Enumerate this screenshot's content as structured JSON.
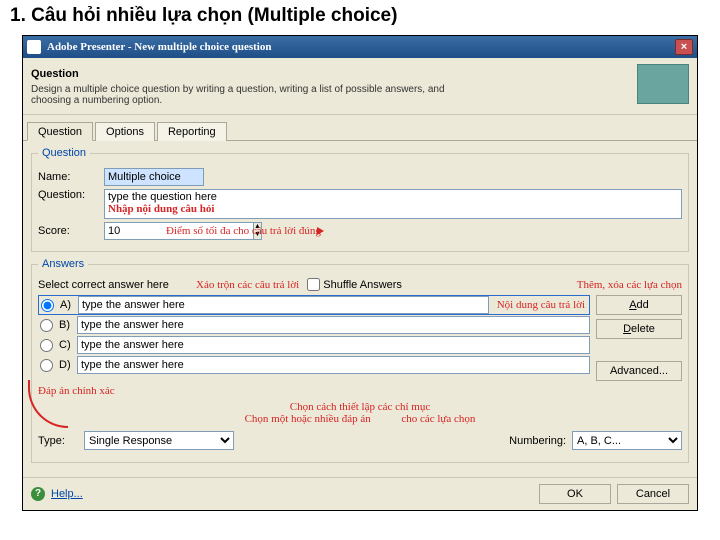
{
  "slide": {
    "title": "1. Câu hỏi nhiều lựa chọn (Multiple choice)"
  },
  "window": {
    "title": "Adobe Presenter - New multiple choice question"
  },
  "header": {
    "title": "Question",
    "desc": "Design a multiple choice question by writing a question, writing a list of possible answers, and choosing a numbering option."
  },
  "tabs": {
    "t1": "Question",
    "t2": "Options",
    "t3": "Reporting"
  },
  "group": {
    "question": "Question",
    "answers": "Answers"
  },
  "labels": {
    "name": "Name:",
    "question": "Question:",
    "score": "Score:",
    "type": "Type:",
    "numbering": "Numbering:",
    "select_hint": "Select correct answer here"
  },
  "fields": {
    "name": "Multiple choice",
    "question": "type the question here",
    "score": "10",
    "answer_ph": "type the answer here",
    "type": "Single Response",
    "numbering": "A, B, C..."
  },
  "letters": {
    "a": "A)",
    "b": "B)",
    "c": "C)",
    "d": "D)"
  },
  "shuffle": "Shuffle Answers",
  "buttons": {
    "add": "Add",
    "delete": "Delete",
    "advanced": "Advanced...",
    "help": "Help...",
    "ok": "OK",
    "cancel": "Cancel"
  },
  "ann": {
    "q_hint": "Nhập nội dung câu hỏi",
    "score_hint": "Điểm số tối đa cho câu trả lời đúng",
    "shuffle_hint": "Xáo trộn các câu trả lời",
    "addremove_hint": "Thêm, xóa các lựa chọn",
    "answer_hint": "Nội dung câu trả lời",
    "correct_hint": "Đáp án chính xác",
    "single_hint": "Chọn một hoặc nhiều đáp án",
    "numbering_hint1": "Chọn cách thiết lập các chỉ mục",
    "numbering_hint2": "cho các lựa chọn"
  }
}
